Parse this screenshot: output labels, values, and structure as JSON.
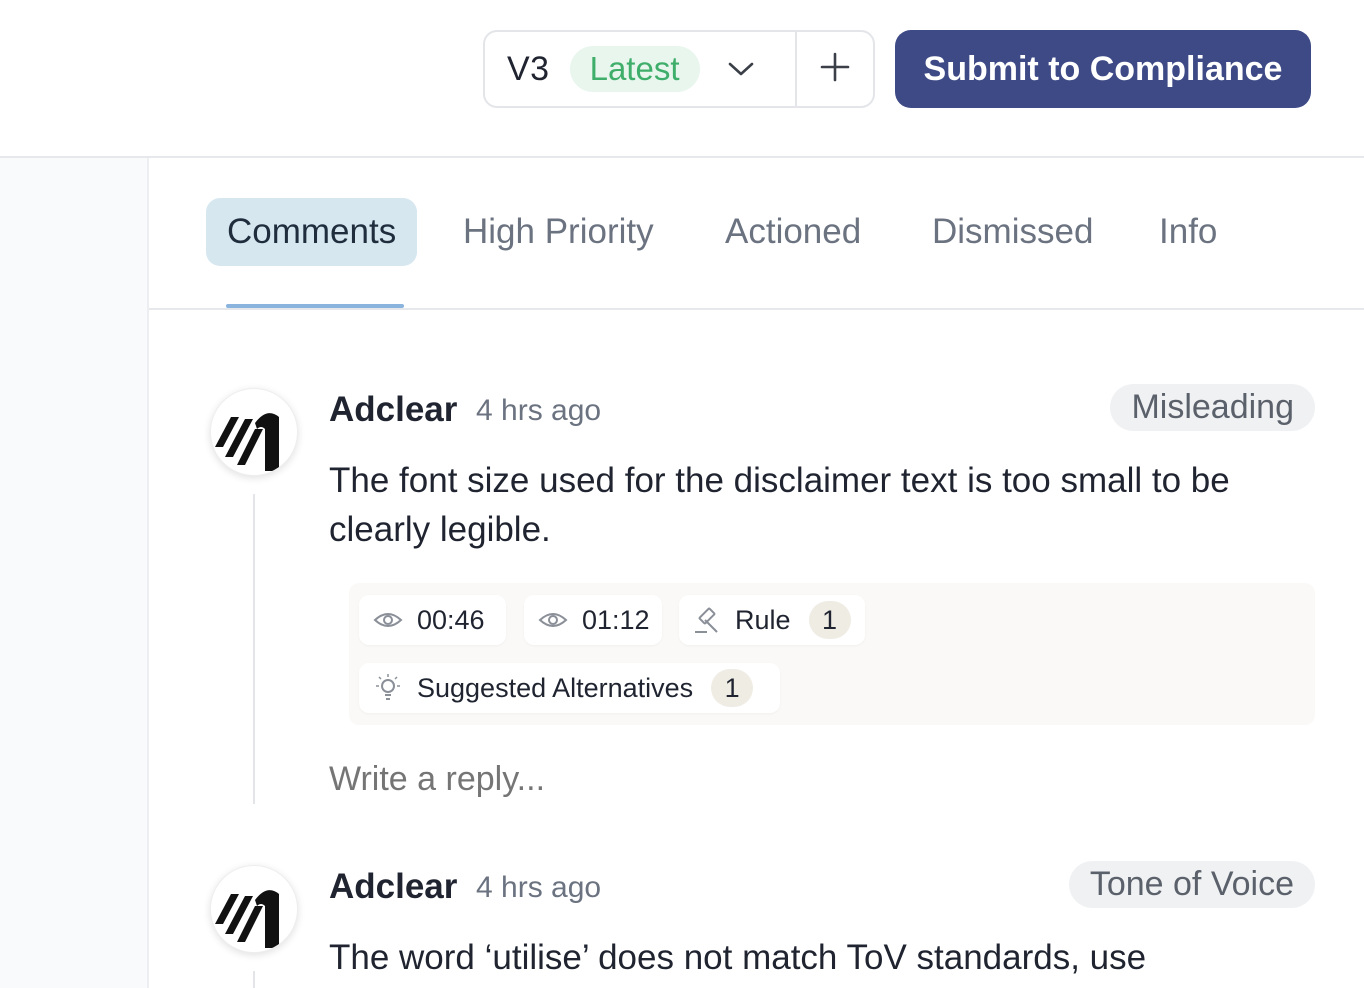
{
  "header": {
    "version": "V3",
    "version_badge": "Latest",
    "submit_label": "Submit to Compliance"
  },
  "tabs": [
    {
      "label": "Comments",
      "active": true
    },
    {
      "label": "High Priority",
      "active": false
    },
    {
      "label": "Actioned",
      "active": false
    },
    {
      "label": "Dismissed",
      "active": false
    },
    {
      "label": "Info",
      "active": false
    }
  ],
  "comments": [
    {
      "author": "Adclear",
      "time": "4 hrs ago",
      "category": "Misleading",
      "text": "The font size used for the disclaimer text is too small to be clearly legible.",
      "timestamps": [
        "00:46",
        "01:12"
      ],
      "rule_label": "Rule",
      "rule_count": "1",
      "alternatives_label": "Suggested Alternatives",
      "alternatives_count": "1",
      "reply_placeholder": "Write a reply..."
    },
    {
      "author": "Adclear",
      "time": "4 hrs ago",
      "category": "Tone of Voice",
      "text": "The word ‘utilise’ does not match ToV standards, use"
    }
  ],
  "icons": {
    "chevron": "chevron-down-icon",
    "plus": "plus-icon",
    "eye": "eye-icon",
    "rule": "gavel-icon",
    "bulb": "lightbulb-icon",
    "avatar_logo": "adclear-logo"
  },
  "colors": {
    "accent": "#3d4a86",
    "latest_text": "#3fae6a",
    "latest_bg": "#e8f6ee",
    "active_tab_bg": "#d6e7f0",
    "tab_underline": "#8ab4dd"
  }
}
